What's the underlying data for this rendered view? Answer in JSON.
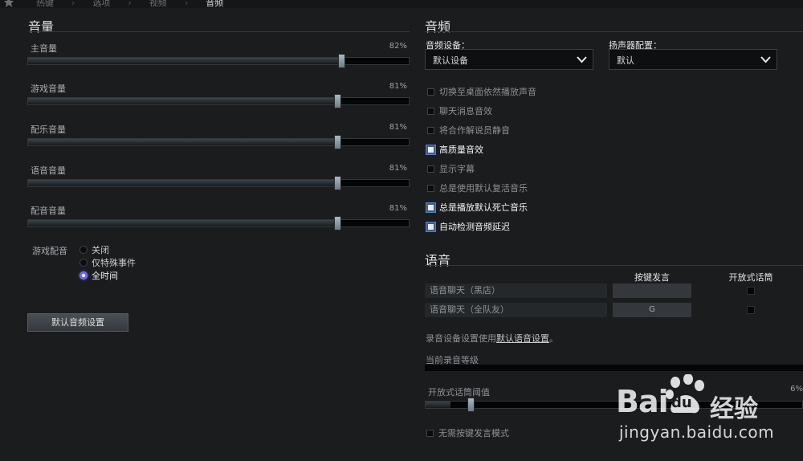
{
  "breadcrumb": {
    "items": [
      "热键",
      "选项",
      "视频",
      "音频"
    ],
    "active_index": 3
  },
  "volume_section": {
    "title": "音量",
    "sliders": [
      {
        "label": "主音量",
        "value_text": "82%",
        "value": 0.82
      },
      {
        "label": "游戏音量",
        "value_text": "81%",
        "value": 0.81
      },
      {
        "label": "配乐音量",
        "value_text": "81%",
        "value": 0.81
      },
      {
        "label": "语音音量",
        "value_text": "81%",
        "value": 0.81
      },
      {
        "label": "配音音量",
        "value_text": "81%",
        "value": 0.81
      }
    ],
    "game_voice": {
      "label": "游戏配音",
      "options": [
        "关闭",
        "仅特殊事件",
        "全时间"
      ],
      "selected_index": 2
    },
    "default_button": "默认音频设置"
  },
  "audio_section": {
    "title": "音频",
    "device": {
      "label": "音频设备：",
      "value": "默认设备"
    },
    "speaker": {
      "label": "扬声器配置：",
      "value": "默认"
    },
    "checkboxes": [
      {
        "label": "切换至桌面依然播放声音",
        "checked": false
      },
      {
        "label": "聊天消息音效",
        "checked": false
      },
      {
        "label": "将合作解说员静音",
        "checked": false
      },
      {
        "label": "高质量音效",
        "checked": true
      },
      {
        "label": "显示字幕",
        "checked": false
      },
      {
        "label": "总是使用默认复活音乐",
        "checked": false
      },
      {
        "label": "总是播放默认死亡音乐",
        "checked": true
      },
      {
        "label": "自动检测音频延迟",
        "checked": true
      }
    ]
  },
  "voice_section": {
    "title": "语音",
    "col_push_to_talk": "按键发言",
    "col_open_mic": "开放式话筒",
    "rows": [
      {
        "label": "语音聊天（黑店）",
        "key": "",
        "open_mic": false
      },
      {
        "label": "语音聊天（全队友）",
        "key": "G",
        "open_mic": false
      }
    ],
    "record_note_prefix": "录音设备设置使用",
    "record_note_link": "默认语音设置",
    "record_note_suffix": "。",
    "record_level_label": "当前录音等级",
    "threshold_label": "开放式话筒阈值",
    "threshold_value_text": "6%",
    "threshold_value": 0.06,
    "no_ptt_label": "无需按键发言模式",
    "no_ptt_checked": false
  },
  "watermark": {
    "brand_left": "Bai",
    "brand_right": "经验",
    "brand_middle": "du",
    "url": "jingyan.baidu.com"
  },
  "colors": {
    "accent_radio": "#5b63ff",
    "checkbox_on_border": "#3b5b8f",
    "handle": "#a9b9c2"
  }
}
